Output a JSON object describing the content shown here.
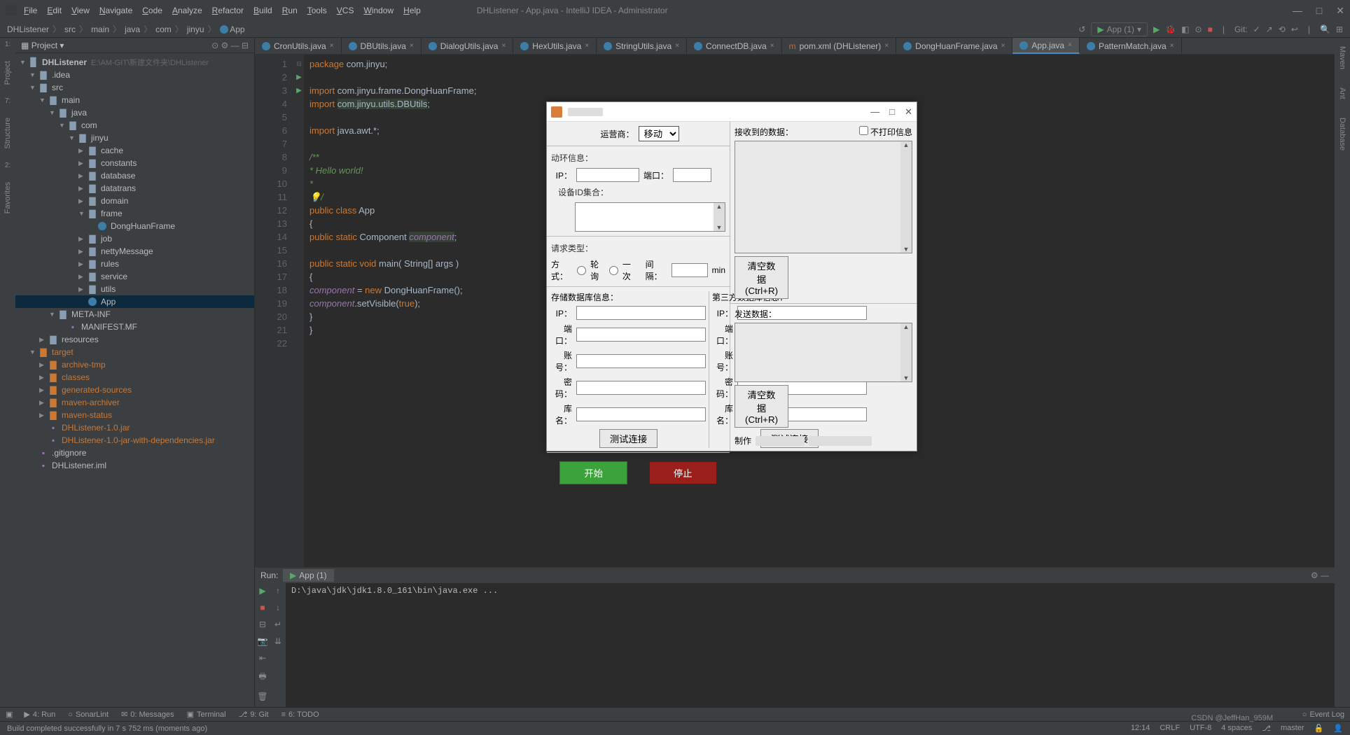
{
  "window": {
    "title": "DHListener - App.java - IntelliJ IDEA - Administrator",
    "menus": [
      "File",
      "Edit",
      "View",
      "Navigate",
      "Code",
      "Analyze",
      "Refactor",
      "Build",
      "Run",
      "Tools",
      "VCS",
      "Window",
      "Help"
    ]
  },
  "breadcrumbs": [
    "DHListener",
    "src",
    "main",
    "java",
    "com",
    "jinyu",
    "App"
  ],
  "toolbar": {
    "run_config": "App (1)",
    "git_label": "Git:"
  },
  "sidebars": {
    "left": [
      {
        "num": "1:",
        "label": "Project"
      },
      {
        "num": "7:",
        "label": "Structure"
      },
      {
        "num": "2:",
        "label": "Favorites"
      }
    ],
    "right": [
      "Maven",
      "Ant",
      "Database"
    ]
  },
  "project_tree": {
    "header": "Project",
    "root": {
      "name": "DHListener",
      "hint": "E:\\AM-GIT\\新建文件夹\\DHListener"
    },
    "nodes": [
      {
        "d": 1,
        "t": "folder-open",
        "n": ".idea",
        "a": "▼"
      },
      {
        "d": 1,
        "t": "folder-open",
        "n": "src",
        "a": "▼"
      },
      {
        "d": 2,
        "t": "folder-open",
        "n": "main",
        "a": "▼"
      },
      {
        "d": 3,
        "t": "folder-open",
        "n": "java",
        "a": "▼"
      },
      {
        "d": 4,
        "t": "folder-open",
        "n": "com",
        "a": "▼"
      },
      {
        "d": 5,
        "t": "folder-open",
        "n": "jinyu",
        "a": "▼"
      },
      {
        "d": 6,
        "t": "folder",
        "n": "cache",
        "a": "▶"
      },
      {
        "d": 6,
        "t": "folder",
        "n": "constants",
        "a": "▶"
      },
      {
        "d": 6,
        "t": "folder",
        "n": "database",
        "a": "▶"
      },
      {
        "d": 6,
        "t": "folder",
        "n": "datatrans",
        "a": "▶"
      },
      {
        "d": 6,
        "t": "folder",
        "n": "domain",
        "a": "▶"
      },
      {
        "d": 6,
        "t": "folder-open",
        "n": "frame",
        "a": "▼"
      },
      {
        "d": 7,
        "t": "class",
        "n": "DongHuanFrame",
        "a": ""
      },
      {
        "d": 6,
        "t": "folder",
        "n": "job",
        "a": "▶"
      },
      {
        "d": 6,
        "t": "folder",
        "n": "nettyMessage",
        "a": "▶"
      },
      {
        "d": 6,
        "t": "folder",
        "n": "rules",
        "a": "▶"
      },
      {
        "d": 6,
        "t": "folder",
        "n": "service",
        "a": "▶"
      },
      {
        "d": 6,
        "t": "folder",
        "n": "utils",
        "a": "▶"
      },
      {
        "d": 6,
        "t": "class",
        "n": "App",
        "a": "",
        "sel": true
      },
      {
        "d": 3,
        "t": "folder-open",
        "n": "META-INF",
        "a": "▼"
      },
      {
        "d": 4,
        "t": "file",
        "n": "MANIFEST.MF",
        "a": ""
      },
      {
        "d": 2,
        "t": "folder",
        "n": "resources",
        "a": "▶"
      },
      {
        "d": 1,
        "t": "folder-orange",
        "n": "target",
        "a": "▼",
        "cls": "orange-txt"
      },
      {
        "d": 2,
        "t": "folder-orange",
        "n": "archive-tmp",
        "a": "▶",
        "cls": "orange-txt"
      },
      {
        "d": 2,
        "t": "folder-orange",
        "n": "classes",
        "a": "▶",
        "cls": "orange-txt"
      },
      {
        "d": 2,
        "t": "folder-orange",
        "n": "generated-sources",
        "a": "▶",
        "cls": "orange-txt"
      },
      {
        "d": 2,
        "t": "folder-orange",
        "n": "maven-archiver",
        "a": "▶",
        "cls": "orange-txt"
      },
      {
        "d": 2,
        "t": "folder-orange",
        "n": "maven-status",
        "a": "▶",
        "cls": "orange-txt"
      },
      {
        "d": 2,
        "t": "file-orange",
        "n": "DHListener-1.0.jar",
        "a": "",
        "cls": "orange-txt"
      },
      {
        "d": 2,
        "t": "file-orange",
        "n": "DHListener-1.0-jar-with-dependencies.jar",
        "a": "",
        "cls": "orange-txt"
      },
      {
        "d": 1,
        "t": "file",
        "n": ".gitignore",
        "a": ""
      },
      {
        "d": 1,
        "t": "file",
        "n": "DHListener.iml",
        "a": ""
      }
    ]
  },
  "editor": {
    "tabs": [
      {
        "label": "CronUtils.java"
      },
      {
        "label": "DBUtils.java"
      },
      {
        "label": "DialogUtils.java"
      },
      {
        "label": "HexUtils.java"
      },
      {
        "label": "StringUtils.java"
      },
      {
        "label": "ConnectDB.java"
      },
      {
        "label": "pom.xml (DHListener)",
        "m": true
      },
      {
        "label": "DongHuanFrame.java"
      },
      {
        "label": "App.java",
        "active": true
      },
      {
        "label": "PatternMatch.java"
      }
    ],
    "lines": [
      {
        "n": 1,
        "h": "<span class='kw'>package</span> com.jinyu;"
      },
      {
        "n": 2,
        "h": ""
      },
      {
        "n": 3,
        "h": "<span class='kw'>import</span> com.jinyu.frame.DongHuanFrame;"
      },
      {
        "n": 4,
        "h": "<span class='kw'>import</span> <span class='hl'>com.jinyu.utils.DBUtils</span>;"
      },
      {
        "n": 5,
        "h": ""
      },
      {
        "n": 6,
        "h": "<span class='kw'>import</span> java.awt.*;"
      },
      {
        "n": 7,
        "h": ""
      },
      {
        "n": 8,
        "h": "<span class='com'>/**</span>",
        "fold": "⊟"
      },
      {
        "n": 9,
        "h": "<span class='com'> * Hello world!</span>"
      },
      {
        "n": 10,
        "h": "<span class='com'> *</span>"
      },
      {
        "n": 11,
        "h": "<span class='com'> <span class='bulb'>💡</span>/</span>"
      },
      {
        "n": 12,
        "h": "<span class='kw'>public class</span> App",
        "run": true
      },
      {
        "n": 13,
        "h": "{"
      },
      {
        "n": 14,
        "h": "    <span class='kw'>public static</span> Component <span class='fld hl'>component</span>;"
      },
      {
        "n": 15,
        "h": ""
      },
      {
        "n": 16,
        "h": "    <span class='kw'>public static void</span> main( String[] args )",
        "run": true
      },
      {
        "n": 17,
        "h": "    {"
      },
      {
        "n": 18,
        "h": "        <span class='fld'>component</span> = <span class='kw'>new</span> DongHuanFrame();"
      },
      {
        "n": 19,
        "h": "        <span class='fld'>component</span>.setVisible(<span class='kw'>true</span>);"
      },
      {
        "n": 20,
        "h": "    }"
      },
      {
        "n": 21,
        "h": "}"
      },
      {
        "n": 22,
        "h": ""
      }
    ]
  },
  "run": {
    "label": "Run:",
    "tab": "App (1)",
    "console": "D:\\java\\jdk\\jdk1.8.0_161\\bin\\java.exe ..."
  },
  "bottom_tabs": [
    {
      "icon": "▶",
      "label": "4: Run"
    },
    {
      "icon": "○",
      "label": "SonarLint"
    },
    {
      "icon": "✉",
      "label": "0: Messages"
    },
    {
      "icon": "▣",
      "label": "Terminal"
    },
    {
      "icon": "⎇",
      "label": "9: Git"
    },
    {
      "icon": "≡",
      "label": "6: TODO"
    }
  ],
  "status": {
    "msg": "Build completed successfully in 7 s 752 ms (moments ago)",
    "pos": "12:14",
    "eol": "CRLF",
    "enc": "UTF-8",
    "indent": "4 spaces",
    "branch": "master",
    "event_log": "Event Log"
  },
  "dialog": {
    "operator_label": "运营商：",
    "operator_value": "移动",
    "dh_info": "动环信息：",
    "ip_label": "IP：",
    "port_label": "端口：",
    "device_ids": "设备ID集合：",
    "req_type": "请求类型：",
    "mode_label": "方式：",
    "mode_poll": "轮询",
    "mode_once": "一次",
    "interval_label": "间隔：",
    "interval_unit": "min",
    "store_db": "存储数据库信息：",
    "third_db": "第三方数据库信息：",
    "account_label": "账号：",
    "password_label": "密码：",
    "dbname_label": "库名：",
    "test_conn": "测试连接",
    "start": "开始",
    "stop": "停止",
    "recv_label": "接收到的数据：",
    "no_print": "不打印信息",
    "clear_data": "清空数据(Ctrl+R)",
    "send_label": "发送数据：",
    "made_by": "制作"
  },
  "watermark": "CSDN @JeffHan_959M"
}
